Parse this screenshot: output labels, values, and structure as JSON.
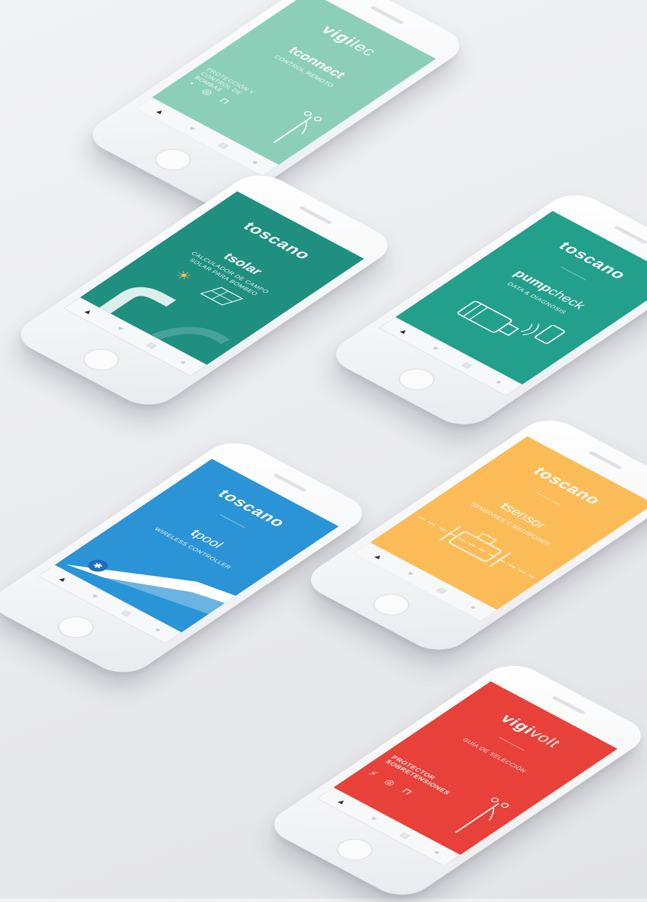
{
  "phones": [
    {
      "brand_main": "vigi",
      "brand_rest": "lec",
      "product_main": "tconnect",
      "product_rest": "",
      "subtitle": "CONTROL REMOTO",
      "side_text": "PROTECCIÓN Y CONTROL DE BOMBAS",
      "color": "#8ccfb9"
    },
    {
      "brand_main": "toscano",
      "brand_rest": "",
      "product_main": "tsolar",
      "product_rest": "",
      "subtitle": "CALCULADOR DE CAMPO SOLAR PARA BOMBEO",
      "side_text": "",
      "color": "#1f8f80"
    },
    {
      "brand_main": "toscano",
      "brand_rest": "",
      "product_main": "pump",
      "product_rest": "check",
      "subtitle": "DATA & DIAGNOSIS",
      "side_text": "",
      "color": "#22a08c"
    },
    {
      "brand_main": "toscano",
      "brand_rest": "",
      "product_main": "t",
      "product_rest": "pool",
      "subtitle": "WIRELESS CONTROLLER",
      "side_text": "",
      "color": "#2a94d6"
    },
    {
      "brand_main": "toscano",
      "brand_rest": "",
      "product_main": "t",
      "product_rest": "sensor",
      "subtitle": "SENSORES Y MEDIDORES",
      "side_text": "",
      "color": "#fbbc58"
    },
    {
      "brand_main": "vigi",
      "brand_rest": "volt",
      "product_main": "",
      "product_rest": "",
      "subtitle": "GUÍA DE SELECCIÓN",
      "side_text": "PROTECTOR SOBRETENSIONES",
      "color": "#e8413a"
    }
  ],
  "icons": {
    "nav_home": "▲",
    "nav_heart": "♥",
    "nav_doc": "▤",
    "nav_user": "●",
    "sun": "☀",
    "bluetooth": "✱",
    "bolt": "⚡"
  }
}
